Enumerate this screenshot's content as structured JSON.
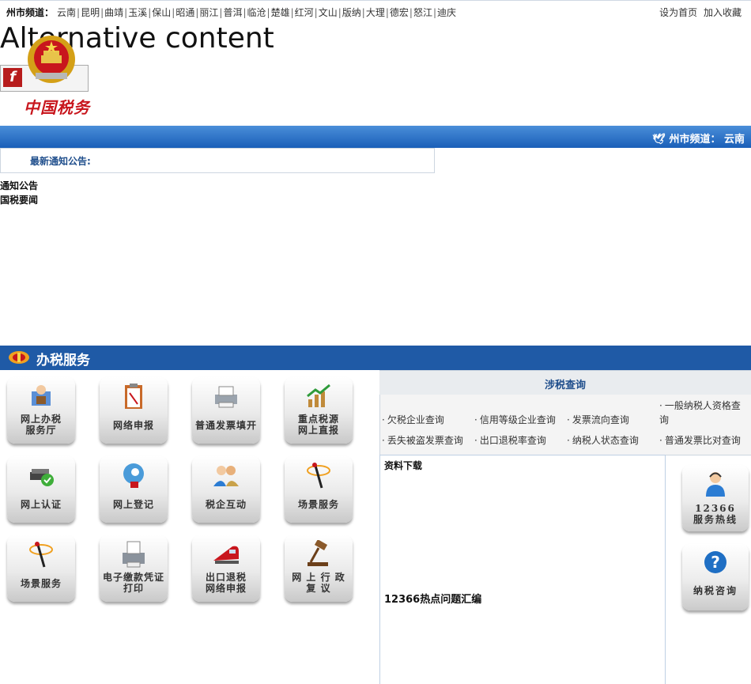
{
  "topbar": {
    "city_label": "州市频道：",
    "cities": [
      "云南",
      "昆明",
      "曲靖",
      "玉溪",
      "保山",
      "昭通",
      "丽江",
      "普洱",
      "临沧",
      "楚雄",
      "红河",
      "文山",
      "版纳",
      "大理",
      "德宏",
      "怒江",
      "迪庆"
    ],
    "set_home": "设为首页",
    "add_favorite": "加入收藏"
  },
  "alt_content": "Alternative content",
  "logo": {
    "text": "中国税务"
  },
  "channel_bar": {
    "text": "州市频道： 云南"
  },
  "notice": {
    "label": "最新通知公告:",
    "section_notice": "通知公告",
    "section_news": "国税要闻"
  },
  "service": {
    "title": "办税服务",
    "tiles": [
      {
        "line1": "网上办税",
        "line2": "服务厅",
        "icon": "service-hall-icon"
      },
      {
        "line1": "网络申报",
        "line2": "",
        "icon": "clipboard-icon"
      },
      {
        "line1": "普通发票填开",
        "line2": "",
        "icon": "printer-icon"
      },
      {
        "line1": "重点税源",
        "line2": "网上直报",
        "icon": "growth-chart-icon"
      },
      {
        "line1": "网上认证",
        "line2": "",
        "icon": "certify-check-icon"
      },
      {
        "line1": "网上登记",
        "line2": "",
        "icon": "register-icon"
      },
      {
        "line1": "税企互动",
        "line2": "",
        "icon": "people-icon"
      },
      {
        "line1": "场景服务",
        "line2": "",
        "icon": "wand-icon"
      },
      {
        "line1": "场景服务",
        "line2": "",
        "icon": "wand-icon"
      },
      {
        "line1": "电子缴款凭证",
        "line2": "打印",
        "icon": "receipt-printer-icon"
      },
      {
        "line1": "出口退税",
        "line2": "网络申报",
        "icon": "train-icon"
      },
      {
        "line1": "网 上 行 政",
        "line2": "复 议",
        "icon": "gavel-icon"
      }
    ]
  },
  "inquiry": {
    "title": "涉税查询",
    "items": [
      "欠税企业查询",
      "信用等级企业查询",
      "发票流向查询",
      "一般纳税人资格查询",
      "丢失被盗发票查询",
      "出口退税率查询",
      "纳税人状态查询",
      "普通发票比对查询"
    ]
  },
  "downloads": {
    "title": "资料下载",
    "hot_title": "12366热点问题汇编"
  },
  "side": {
    "hotline_number": "12366",
    "hotline_label": "服务热线",
    "consult_label": "纳税咨询"
  },
  "colors": {
    "brand_blue": "#1f5aa6",
    "emblem_red": "#c8161d",
    "title_blue": "#1f4e8c"
  }
}
